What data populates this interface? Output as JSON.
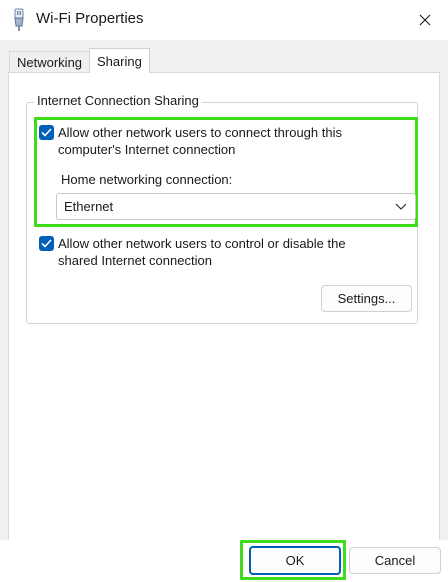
{
  "window": {
    "title": "Wi-Fi Properties",
    "icon": "network-adapter-icon",
    "close_icon": "close-icon"
  },
  "tabs": [
    {
      "label": "Networking",
      "selected": false
    },
    {
      "label": "Sharing",
      "selected": true
    }
  ],
  "sharing": {
    "group_title": "Internet Connection Sharing",
    "allow_connect": {
      "checked": true,
      "line1": "Allow other network users to connect through this",
      "line2": "computer's Internet connection"
    },
    "home_networking": {
      "label": "Home networking connection:",
      "selected": "Ethernet"
    },
    "allow_control": {
      "checked": true,
      "line1": "Allow other network users to control or disable the",
      "line2": "shared Internet connection"
    },
    "settings_button": "Settings..."
  },
  "footer": {
    "ok_label": "OK",
    "cancel_label": "Cancel"
  },
  "colors": {
    "accent": "#005fb8",
    "highlight": "#3fdc1c"
  }
}
